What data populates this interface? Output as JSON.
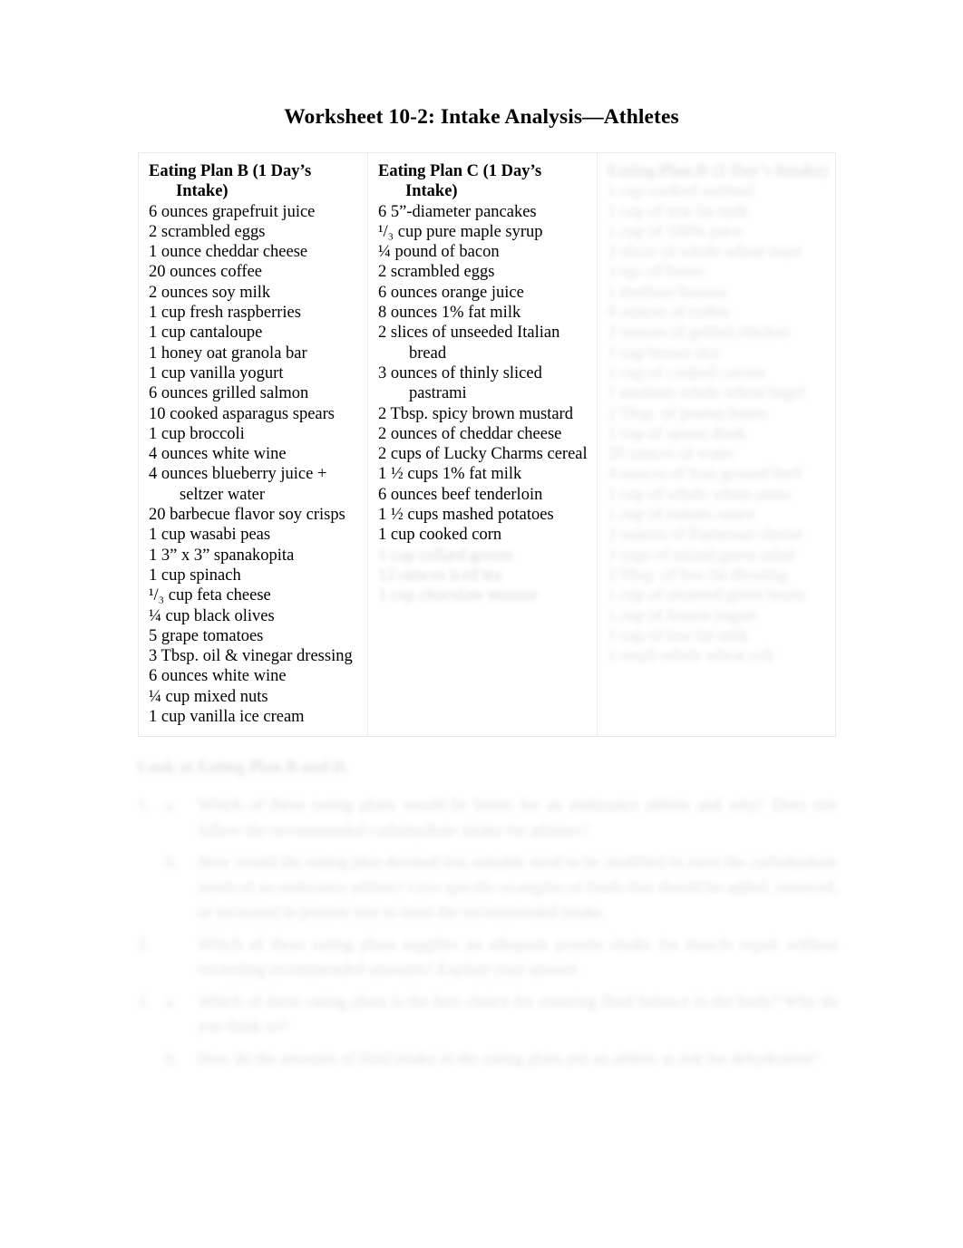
{
  "document": {
    "title": "Worksheet 10-2: Intake Analysis—Athletes"
  },
  "table": {
    "columns": [
      {
        "id": "plan-b",
        "header": "Eating Plan B (1 Day’s Intake)",
        "legible": true,
        "items": [
          "6 ounces grapefruit juice",
          "2 scrambled eggs",
          "1 ounce cheddar cheese",
          "20 ounces coffee",
          "2 ounces soy milk",
          "1 cup fresh raspberries",
          "1 cup cantaloupe",
          "1 honey oat granola bar",
          "1 cup vanilla yogurt",
          "6 ounces grilled salmon",
          "10 cooked asparagus spears",
          "1 cup broccoli",
          "4 ounces white wine",
          "4 ounces blueberry juice + seltzer water",
          "20 barbecue flavor soy crisps",
          "1 cup wasabi peas",
          "1 3” x 3” spanakopita",
          "1 cup spinach",
          "¹/₃ cup feta cheese",
          "¼ cup black olives",
          "5 grape tomatoes",
          "3 Tbsp. oil & vinegar dressing",
          "6 ounces white wine",
          "¼ cup mixed nuts",
          "1 cup vanilla ice cream"
        ]
      },
      {
        "id": "plan-c",
        "header": "Eating Plan C (1 Day’s Intake)",
        "legible": true,
        "items": [
          "6 5”-diameter pancakes",
          "¹/₃ cup pure maple syrup",
          "¼ pound of bacon",
          "2 scrambled eggs",
          "6 ounces orange juice",
          "8 ounces 1% fat milk",
          "2 slices of unseeded Italian bread",
          "3 ounces of thinly sliced pastrami",
          "2 Tbsp. spicy brown mustard",
          "2 ounces of cheddar cheese",
          "2 cups of Lucky Charms cereal",
          "1 ½ cups 1% fat milk",
          "6 ounces beef tenderloin",
          "1 ½ cups mashed potatoes",
          "1 cup cooked corn"
        ],
        "illegible_items": [
          "1 cup collard greens",
          "12 ounces iced tea",
          "1 cup chocolate mousse"
        ]
      },
      {
        "id": "plan-d",
        "header": "Eating Plan D (1 Day’s Intake)",
        "legible": false,
        "items": [
          "1 cup cooked oatmeal",
          "1 cup of low fat milk",
          "1 cup of 100% juice",
          "2 slices of whole wheat toast",
          "2 tsp. of butter",
          "1 medium banana",
          "8 ounces of coffee",
          "2 ounces of grilled chicken",
          "1 cup brown rice",
          "1 cup of cooked carrots",
          "1 medium whole wheat bagel",
          "2 Tbsp. of peanut butter",
          "1 cup of sports drink",
          "20 ounces of water",
          "4 ounces of lean ground beef",
          "1 cup of whole wheat pasta",
          "1 cup of tomato sauce",
          "2 ounces of Parmesan cheese",
          "2 cups of mixed green salad",
          "2 Tbsp. of low fat dressing",
          "1 cup of steamed green beans",
          "1 cup of frozen yogurt",
          "1 cup of low fat milk",
          "1 small whole wheat roll"
        ]
      }
    ]
  },
  "questions": {
    "intro": "Look at Eating Plan B and D.",
    "items": [
      {
        "number": "1.",
        "sub": "a.",
        "text": "Which of these eating plans would be better for an endurance athlete and why? Does one follow the recommended carbohydrate intake for athletes?"
      },
      {
        "number": "",
        "sub": "b.",
        "text": "How would the eating plan deemed less suitable need to be modified to meet the carbohydrate needs of an endurance athlete? Give specific examples of foods that should be added, removed, or increased in portion size to meet the recommended intake."
      },
      {
        "number": "2.",
        "sub": "",
        "text": "Which of these eating plans supplies an adequate protein intake for muscle repair without exceeding recommended amounts? Explain your answer."
      },
      {
        "number": "3.",
        "sub": "a.",
        "text": "Which of these eating plans is the best choice for ensuring fluid balance in the body? Why do you think so?"
      },
      {
        "number": "",
        "sub": "b.",
        "text": "How do the amounts of fluid intake in the eating plans put an athlete at risk for dehydration?"
      }
    ]
  }
}
